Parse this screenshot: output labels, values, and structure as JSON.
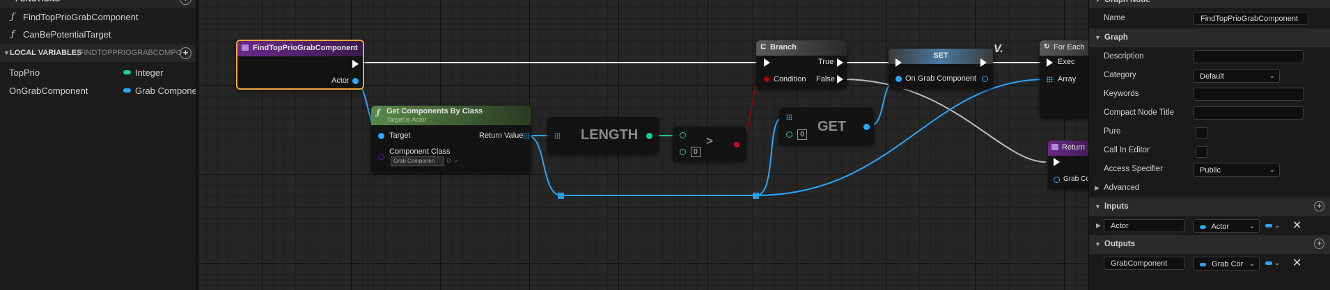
{
  "left_panel": {
    "functions_header": "FUNCTIONS",
    "functions": [
      {
        "glyph": "ƒ",
        "name": "FindTopPrioGrabComponent"
      },
      {
        "glyph": "ƒ",
        "name": "CanBePotentialTarget"
      }
    ],
    "local_vars_header": "LOCAL VARIABLES",
    "local_vars_scope": "(FINDTOPPRIOGRABCOMPO",
    "variables": [
      {
        "name": "TopPrio",
        "type": "Integer",
        "color": "#1dcc9a"
      },
      {
        "name": "OnGrabComponent",
        "type": "Grab Compone",
        "color": "#2aa7ff"
      }
    ]
  },
  "graph": {
    "entry_node": {
      "title": "FindTopPrioGrabComponent",
      "pin_actor": "Actor"
    },
    "get_components": {
      "title": "Get Components By Class",
      "subtitle": "Target is Actor",
      "pin_target": "Target",
      "pin_return": "Return Value",
      "pin_class": "Component Class",
      "class_value": "Grab Componen"
    },
    "length_node": {
      "label": "LENGTH"
    },
    "compare_node": {
      "label": ">",
      "value": "0"
    },
    "branch_node": {
      "title": "Branch",
      "pin_condition": "Condition",
      "pin_true": "True",
      "pin_false": "False"
    },
    "get_node": {
      "label": "GET",
      "index": "0"
    },
    "set_node": {
      "title": "SET",
      "pin_var": "On Grab Component"
    },
    "foreach_node": {
      "title": "For Each",
      "pin_exec": "Exec",
      "pin_array": "Array"
    },
    "return_node": {
      "title": "Return",
      "pin_grab": "Grab Co"
    },
    "colors": {
      "exec": "#ffffff",
      "object": "#2aa7ff",
      "int": "#1dcc9a",
      "bool": "#b00000",
      "accent": "#f4a93a"
    }
  },
  "details": {
    "graph_node_header": "Graph Node",
    "name_label": "Name",
    "name_value": "FindTopPrioGrabComponent",
    "graph_header": "Graph",
    "description_label": "Description",
    "description_value": "",
    "category_label": "Category",
    "category_value": "Default",
    "keywords_label": "Keywords",
    "keywords_value": "",
    "compact_label": "Compact Node Title",
    "compact_value": "",
    "pure_label": "Pure",
    "call_in_editor_label": "Call In Editor",
    "access_label": "Access Specifier",
    "access_value": "Public",
    "advanced_label": "Advanced",
    "inputs_header": "Inputs",
    "input_name": "Actor",
    "input_type": "Actor",
    "outputs_header": "Outputs",
    "output_name": "GrabComponent",
    "output_type": "Grab Cor"
  }
}
